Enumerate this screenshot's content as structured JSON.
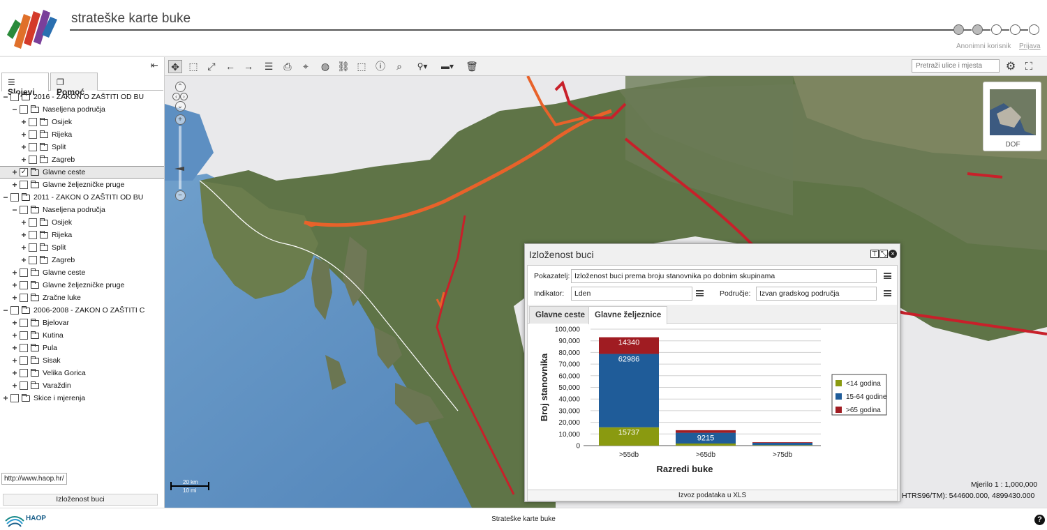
{
  "header": {
    "title": "strateške karte buke",
    "user": "Anonimni korisnik",
    "login": "Prijava",
    "steps": [
      true,
      true,
      false,
      false,
      false
    ]
  },
  "left_panel": {
    "tabs": [
      {
        "label": "Slojevi",
        "icon": "layers-icon"
      },
      {
        "label": "Pomoć",
        "icon": "help-page-icon"
      }
    ],
    "tree": [
      {
        "label": "2016 - ZAKON O ZAŠTITI OD BU",
        "level": 0,
        "expander": "−",
        "checked": false
      },
      {
        "label": "Naseljena područja",
        "level": 1,
        "expander": "−",
        "checked": false
      },
      {
        "label": "Osijek",
        "level": 2,
        "expander": "+",
        "checked": false
      },
      {
        "label": "Rijeka",
        "level": 2,
        "expander": "+",
        "checked": false
      },
      {
        "label": "Split",
        "level": 2,
        "expander": "+",
        "checked": false
      },
      {
        "label": "Zagreb",
        "level": 2,
        "expander": "+",
        "checked": false
      },
      {
        "label": "Glavne ceste",
        "level": 1,
        "expander": "+",
        "checked": true,
        "selected": true
      },
      {
        "label": "Glavne željezničke pruge",
        "level": 1,
        "expander": "+",
        "checked": false
      },
      {
        "label": "2011 - ZAKON O ZAŠTITI OD BU",
        "level": 0,
        "expander": "−",
        "checked": false
      },
      {
        "label": "Naseljena područja",
        "level": 1,
        "expander": "−",
        "checked": false
      },
      {
        "label": "Osijek",
        "level": 2,
        "expander": "+",
        "checked": false
      },
      {
        "label": "Rijeka",
        "level": 2,
        "expander": "+",
        "checked": false
      },
      {
        "label": "Split",
        "level": 2,
        "expander": "+",
        "checked": false
      },
      {
        "label": "Zagreb",
        "level": 2,
        "expander": "+",
        "checked": false
      },
      {
        "label": "Glavne ceste",
        "level": 1,
        "expander": "+",
        "checked": false
      },
      {
        "label": "Glavne željezničke pruge",
        "level": 1,
        "expander": "+",
        "checked": false
      },
      {
        "label": "Zračne luke",
        "level": 1,
        "expander": "+",
        "checked": false
      },
      {
        "label": "2006-2008 - ZAKON O ZAŠTITI C",
        "level": 0,
        "expander": "−",
        "checked": false
      },
      {
        "label": "Bjelovar",
        "level": 1,
        "expander": "+",
        "checked": false
      },
      {
        "label": "Kutina",
        "level": 1,
        "expander": "+",
        "checked": false
      },
      {
        "label": "Pula",
        "level": 1,
        "expander": "+",
        "checked": false
      },
      {
        "label": "Sisak",
        "level": 1,
        "expander": "+",
        "checked": false
      },
      {
        "label": "Velika Gorica",
        "level": 1,
        "expander": "+",
        "checked": false
      },
      {
        "label": "Varaždin",
        "level": 1,
        "expander": "+",
        "checked": false
      },
      {
        "label": "Skice i mjerenja",
        "level": 0,
        "expander": "+",
        "checked": false
      }
    ],
    "url_tooltip": "http://www.haop.hr/",
    "bottom_button": "Izloženost buci"
  },
  "toolbar": {
    "search_placeholder": "Pretraži ulice i mjesta",
    "tools": [
      {
        "name": "pan-tool",
        "glyph": "✥",
        "active": true
      },
      {
        "name": "zoom-box-tool",
        "glyph": "⬚"
      },
      {
        "name": "zoom-extent-tool",
        "glyph": "⤢"
      },
      {
        "name": "back-tool",
        "glyph": "←"
      },
      {
        "name": "forward-tool",
        "glyph": "→"
      },
      {
        "name": "layer-order-tool",
        "glyph": "☰"
      },
      {
        "name": "print-tool",
        "glyph": "⎙"
      },
      {
        "name": "coordinates-tool",
        "glyph": "⌖"
      },
      {
        "name": "web-services-tool",
        "glyph": "◍"
      },
      {
        "name": "link-tool",
        "glyph": "⛓"
      },
      {
        "name": "select-info-tool",
        "glyph": "⬚"
      },
      {
        "name": "info-tool",
        "glyph": "ⓘ"
      },
      {
        "name": "search-tool",
        "glyph": "⌕"
      },
      {
        "name": "marker-tool",
        "glyph": "⚲▾"
      },
      {
        "name": "measure-tool",
        "glyph": "▬▾"
      },
      {
        "name": "clear-tool",
        "glyph": "🗑"
      }
    ]
  },
  "map": {
    "scale_km": "20 km",
    "scale_mi": "10 mi",
    "map_scale": "Mjerilo 1 : 1,000,000",
    "coordinates": "HTRS96/TM):  544600.000, 4899430.000",
    "minimap_label": "DOF"
  },
  "popup": {
    "title": "Izloženost buci",
    "indicator_label": "Pokazatelj:",
    "indicator_value": "Izloženost buci prema broju stanovnika po dobnim skupinama",
    "index_label": "Indikator:",
    "index_value": "Lden",
    "area_label": "Područje:",
    "area_value": "Izvan gradskog područja",
    "tabs": [
      {
        "label": "Glavne ceste",
        "active": false
      },
      {
        "label": "Glavne željeznice",
        "active": true
      }
    ],
    "export_button": "Izvoz podataka u XLS"
  },
  "chart_data": {
    "type": "bar",
    "stacked": true,
    "categories": [
      ">55db",
      ">65db",
      ">75db"
    ],
    "series": [
      {
        "name": "<14 godina",
        "color": "#8a9a10",
        "values": [
          15737,
          1800,
          400
        ]
      },
      {
        "name": "15-64 godine",
        "color": "#1f5c99",
        "values": [
          62986,
          9215,
          2000
        ]
      },
      {
        "name": ">65 godina",
        "color": "#a01c22",
        "values": [
          14340,
          2200,
          500
        ]
      }
    ],
    "data_labels": [
      {
        "category": 0,
        "series": 0,
        "text": "15737"
      },
      {
        "category": 0,
        "series": 1,
        "text": "62986"
      },
      {
        "category": 0,
        "series": 2,
        "text": "14340"
      },
      {
        "category": 1,
        "series": 1,
        "text": "9215"
      }
    ],
    "ylim": [
      0,
      100000
    ],
    "yticks": [
      "0",
      "10,000",
      "20,000",
      "30,000",
      "40,000",
      "50,000",
      "60,000",
      "70,000",
      "80,000",
      "90,000",
      "100,000"
    ],
    "xlabel": "Razredi buke",
    "ylabel": "Broj stanovnika",
    "legend": "right",
    "grid": true
  },
  "footer": {
    "brand": "HAOP",
    "text": "Strateške karte buke"
  }
}
